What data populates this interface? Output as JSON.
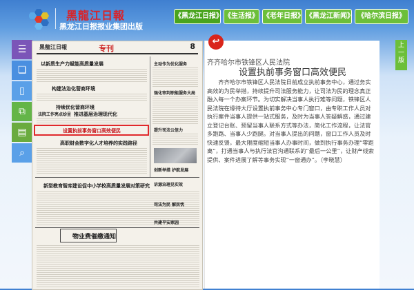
{
  "header": {
    "logo_title": "黑龍江日報",
    "logo_subtitle": "黑龙江日报报业集团出版"
  },
  "nav": [
    {
      "label": "《黑龙江日报》",
      "active": true
    },
    {
      "label": "《生活报》",
      "active": false
    },
    {
      "label": "《老年日报》",
      "active": false
    },
    {
      "label": "《黑龙江新闻》",
      "active": false
    },
    {
      "label": "《哈尔滨日报》",
      "active": false
    }
  ],
  "toolbar": [
    {
      "icon": "menu-icon",
      "glyph": "☰"
    },
    {
      "icon": "pages-icon",
      "glyph": "❏"
    },
    {
      "icon": "phone-icon",
      "glyph": "▯"
    },
    {
      "icon": "copy-icon",
      "glyph": "⧉"
    },
    {
      "icon": "document-icon",
      "glyph": "▤"
    },
    {
      "icon": "search-icon",
      "glyph": "⌕"
    }
  ],
  "newspaper": {
    "masthead": "黑龍江日報",
    "section": "专刊",
    "page_number": "8",
    "headlines": [
      "以新质生产力赋能高质量发展",
      "构建法治化营商环境",
      "持续优化营商环境",
      "法院工作亮点纷呈",
      "推进基层治理现代化",
      "设置执前事务窗口高效便民",
      "高职财会数字化人才培养的实践路径",
      "新型教育智库建设促中小学校高质量发展对策研究",
      "物业费催缴通知"
    ],
    "right_headlines": [
      "主动作为优化服务",
      "强化审判职能服务大局",
      "提升司法公信力",
      "创新举措 护航发展",
      "诉源治理见实效",
      "司法为民 解民忧",
      "共建平安家园"
    ]
  },
  "article": {
    "back_label": "↩",
    "subtitle": "齐齐哈尔市铁锋区人民法院",
    "title": "设置执前事务窗口高效便民",
    "body": "齐齐哈尔市铁锋区人民法院日前成立执前事务中心，通过务实高效的为民举措，持续提升司法服务能力，让司法为民的理念真正融入每一个办案环节。为切实解决当事人执行难等问题，铁锋区人民法院在缘待大厅设置执前事务中心专门窗口，由专职工作人员对执行案件当事人提供一站式服务，及时为当事人答疑解惑，通过建立登记台账、预留当事人联系方式等办法，简化工作流程，让法官多跑路、当事人少跑腿。对当事人提出的问题，窗口工作人员及时快速反馈，最大限度缩短当事人办事时间，做到执行事务办理“零距离”，打通当事人与执行法官沟通联系的“最后一公里”，让财产线索提供、案件进展了解等事务实现“一窗通办”。（李晓慧）"
  },
  "side_tab": "上一版"
}
